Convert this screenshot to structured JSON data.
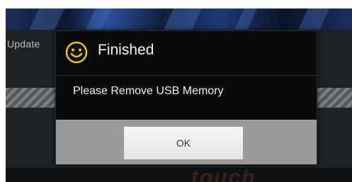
{
  "background": {
    "screen_title": "Update",
    "brand_text": "touch",
    "top_bar_color": "#1b2f5a",
    "progress_colors": [
      "#7c8083",
      "#55595c"
    ]
  },
  "dialog": {
    "icon": "smiley-face-icon",
    "icon_color": "#e3c619",
    "title": "Finished",
    "message": "Please Remove USB Memory",
    "ok_label": "OK"
  }
}
